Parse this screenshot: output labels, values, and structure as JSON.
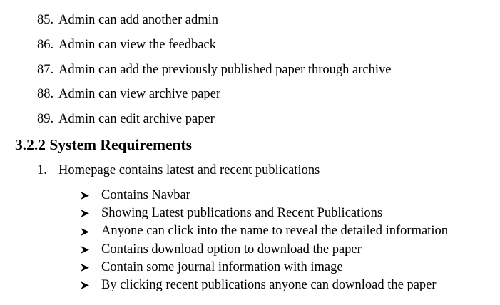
{
  "admin_items": [
    {
      "number": "85.",
      "text": "Admin can add another admin"
    },
    {
      "number": "86.",
      "text": "Admin can view the feedback"
    },
    {
      "number": "87.",
      "text": "Admin can add the previously published paper through archive"
    },
    {
      "number": "88.",
      "text": "Admin can view archive paper"
    },
    {
      "number": "89.",
      "text": "Admin can edit archive paper"
    }
  ],
  "section": {
    "heading": "3.2.2 System Requirements"
  },
  "system_items": [
    {
      "number": "1.",
      "text": "Homepage contains latest and recent publications"
    }
  ],
  "homepage_features": [
    "Contains Navbar",
    "Showing Latest publications and Recent Publications",
    "Anyone can click into the name to reveal the detailed information",
    "Contains download option to download the paper",
    "Contain some journal information with image",
    "By clicking recent publications anyone can download the paper"
  ],
  "icons": {
    "bullet": "arrowhead-bullet-icon"
  }
}
